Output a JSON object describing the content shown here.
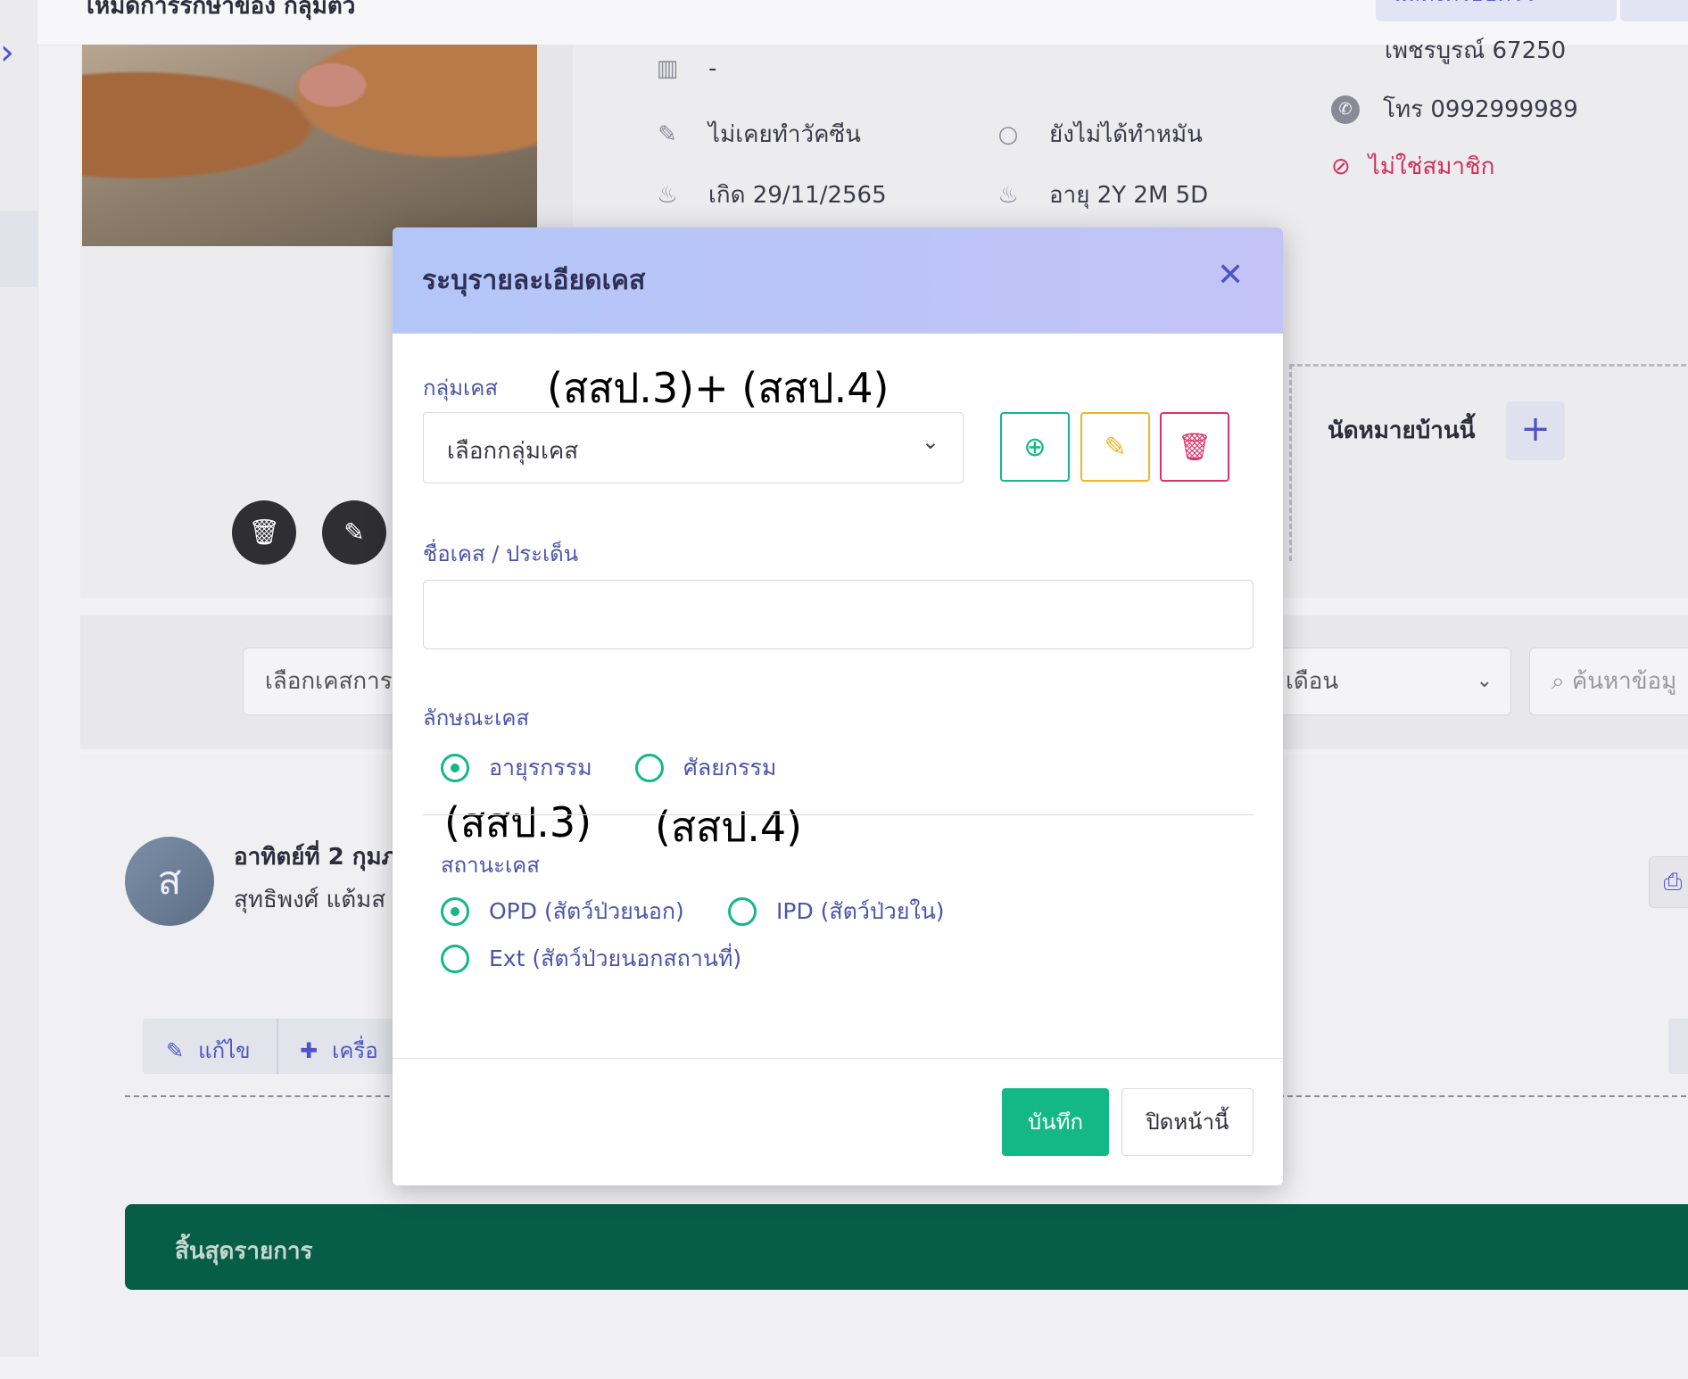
{
  "header": {
    "title": "โหมดการรักษาของ กลุ่มตัว",
    "right_button": "แสดงครอบครัว"
  },
  "pet": {
    "barcode": "-",
    "vaccine_status": "ไม่เคยทำวัคซีน",
    "neuter_status": "ยังไม่ได้ทำหมัน",
    "birth": "เกิด 29/11/2565",
    "age": "อายุ 2Y 2M 5D"
  },
  "owner": {
    "address": "เพชรบูรณ์ 67250",
    "phone": "โทร 0992999989",
    "member_status": "ไม่ใช่สมาชิก"
  },
  "appointment": {
    "label": "นัดหมายบ้านนี้",
    "add_symbol": "+"
  },
  "filters": {
    "case_select": "เลือกเคสการ",
    "month_select": "เดือน",
    "search_placeholder": "ค้นหาข้อมู"
  },
  "log": {
    "avatar_letter": "ส",
    "date": "อาทิตย์ที่ 2 กุมภ",
    "user": "สุทธิพงศ์ แต้มส",
    "edit_label": "แก้ไข",
    "tool_label": "เครื่อ"
  },
  "end_banner": "สิ้นสุดรายการ",
  "modal": {
    "title": "ระบุรายละเอียดเคส",
    "close_symbol": "✕",
    "group_label": "กลุ่มเคส",
    "group_annotation": "(สสป.3)+ (สสป.4)",
    "group_select": "เลือกกลุ่มเคส",
    "name_label": "ชื่อเคส / ประเด็น",
    "name_value": "",
    "type_label": "ลักษณะเคส",
    "type_options": [
      "อายุรกรรม",
      "ศัลยกรรม"
    ],
    "type_annotations": [
      "(สสป.3)",
      "(สสป.4)"
    ],
    "status_label": "สถานะเคส",
    "status_options": [
      "OPD (สัตว์ป่วยนอก)",
      "IPD (สัตว์ป่วยใน)",
      "Ext (สัตว์ป่วยนอกสถานที่)"
    ],
    "save_label": "บันทึก",
    "close_label": "ปิดหน้านี้"
  },
  "colors": {
    "accent": "#4b55c7",
    "success": "#14b887",
    "warning": "#f0b429",
    "danger": "#e0306a",
    "banner": "#075e47"
  }
}
